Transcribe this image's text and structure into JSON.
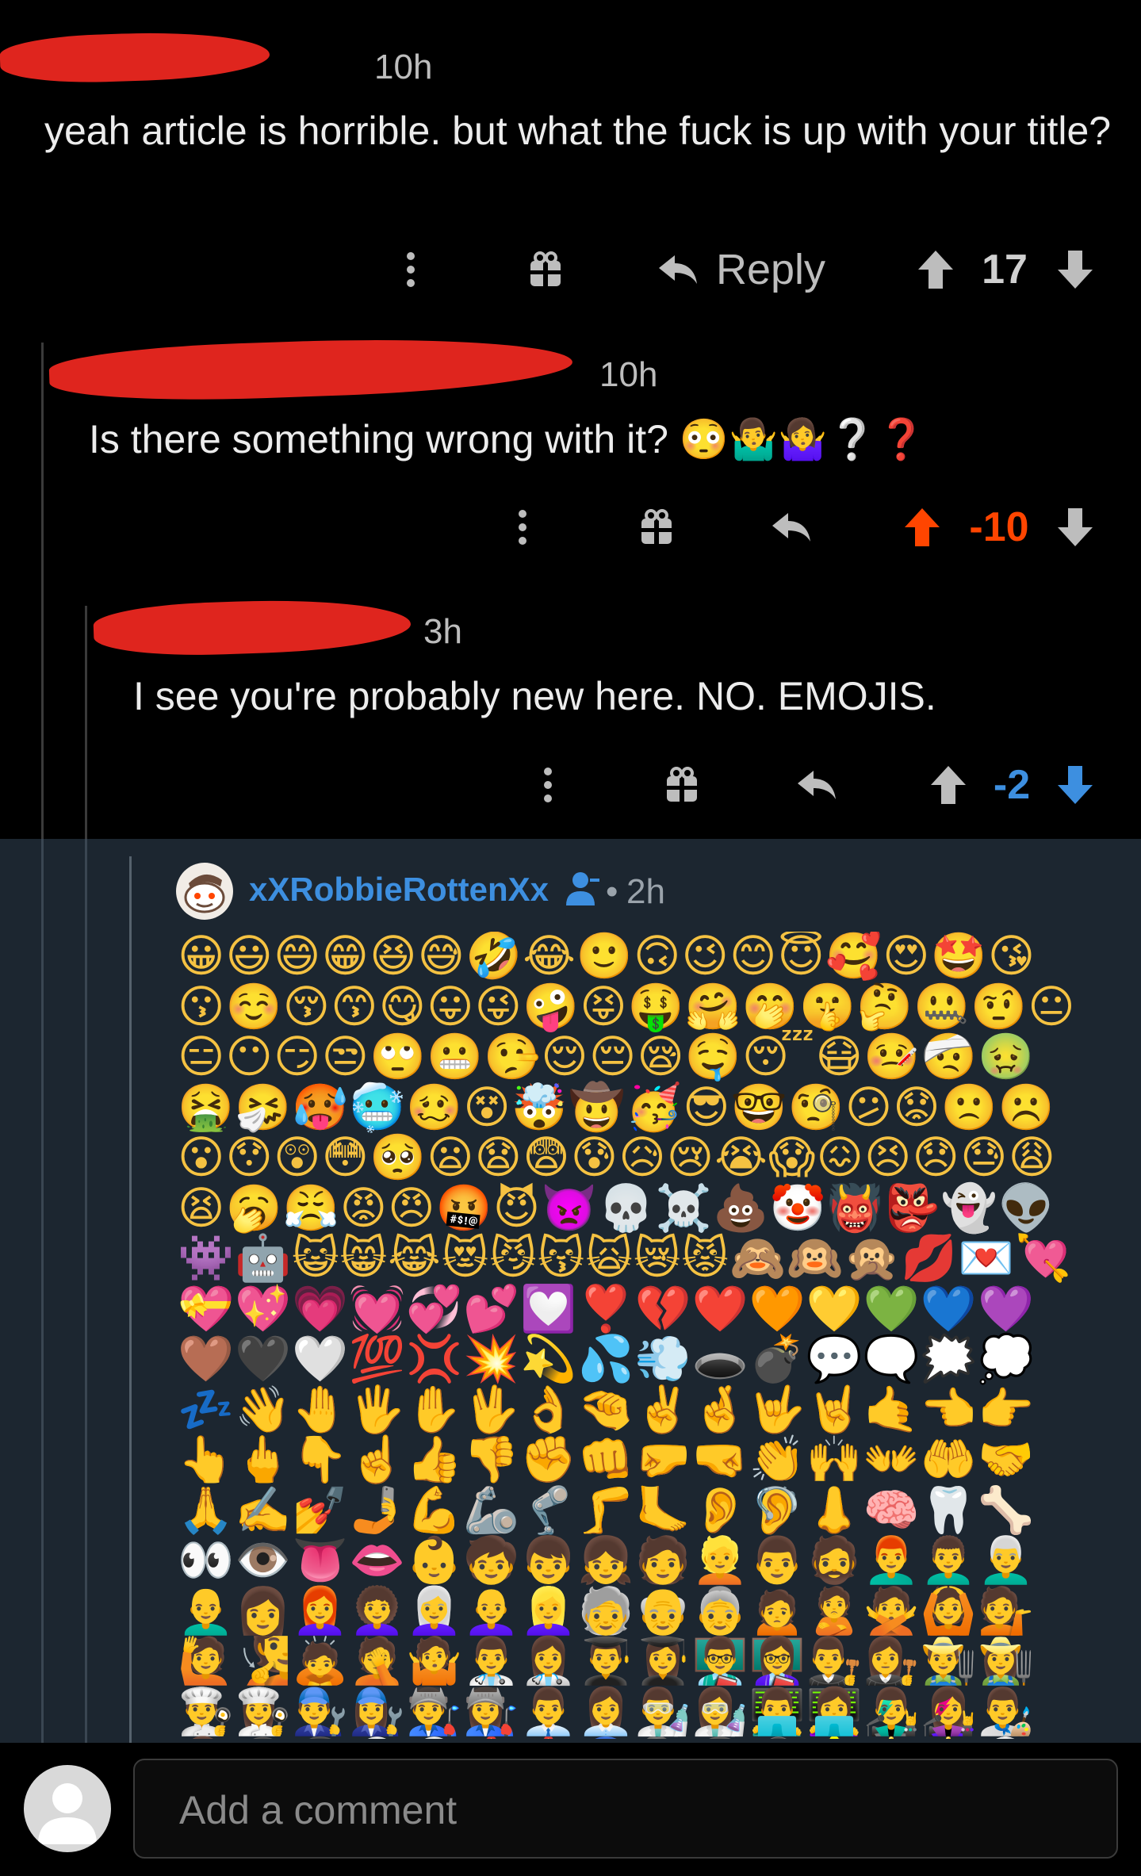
{
  "comments": [
    {
      "time": "10h",
      "body": "yeah article is horrible. but what the fuck is up with your title?",
      "reply_label": "Reply",
      "score": "17"
    },
    {
      "time": "10h",
      "body": "Is there something wrong with it? 😳🤷‍♂️🤷‍♀️❔❓",
      "score": "-10"
    },
    {
      "time": "3h",
      "body": "I see you're probably new here. NO. EMOJIS.",
      "score": "-2"
    },
    {
      "username": "xXRobbieRottenXx",
      "separator": "•",
      "time": "2h",
      "emoji_body": "😀😃😄😁😆😅🤣😂🙂🙃😉😊😇🥰😍🤩😘😗☺️😚😙😋😛😜🤪😝🤑🤗🤭🤫🤔🤐🤨😐😑😶😏😒🙄😬🤥😌😔😪🤤😴😷🤒🤕🤢🤮🤧🥵🥶🥴😵🤯🤠🥳😎🤓🧐😕😟🙁☹️😮😯😲😳🥺😦😧😨😰😥😢😭😱😖😣😞😓😩😫🥱😤😡😠🤬😈👿💀☠️💩🤡👹👺👻👽👾🤖😺😸😹😻😼😽🙀😿😾🙈🙉🙊💋💌💘💝💖💗💓💞💕💟❣️💔❤️🧡💛💚💙💜🤎🖤🤍💯💢💥💫💦💨🕳️💣💬🗨️🗯️💭💤👋🤚🖐️✋🖖👌🤏✌️🤞🤟🤘🤙👈👉👆🖕👇☝️👍👎✊👊🤛🤜👏🙌👐🤲🤝🙏✍️💅🤳💪🦾🦿🦵🦶👂🦻👃🧠🦷🦴👀👁️👅👄👶🧒👦👧🧑👱👨🧔👨‍🦰👨‍🦱👨‍🦳👨‍🦲👩👩‍🦰👩‍🦱👩‍🦳👩‍🦲👱‍♀️🧓👴👵🙍🙎🙅🙆💁🙋🧏🙇🤦🤷👨‍⚕️👩‍⚕️👨‍🎓👩‍🎓👨‍🏫👩‍🏫👨‍⚖️👩‍⚖️👨‍🌾👩‍🌾👨‍🍳👩‍🍳👨‍🔧👩‍🔧👨‍🏭👩‍🏭👨‍💼👩‍💼👨‍🔬👩‍🔬👨‍💻👩‍💻👨‍🎤👩‍🎤👨‍🎨👩‍🎨👨‍✈️👩‍✈️👨‍🚀👩‍🚀👨‍🚒👩‍🚒👮🕵️💂🥷👷🤴👸👳👲🧕🤵👰🤰🤱👼"
    }
  ],
  "composer": {
    "placeholder": "Add a comment"
  },
  "colors": {
    "background": "#000000",
    "reply_highlight": "#1c2630",
    "upvote_active": "#ff4500",
    "downvote_active": "#3d8fe0",
    "username": "#3d8fe0",
    "redaction": "#e8271f"
  },
  "icons": [
    "more-icon",
    "gift-icon",
    "reply-icon",
    "upvote-icon",
    "downvote-icon",
    "user-avatar-icon",
    "profile-icon"
  ]
}
